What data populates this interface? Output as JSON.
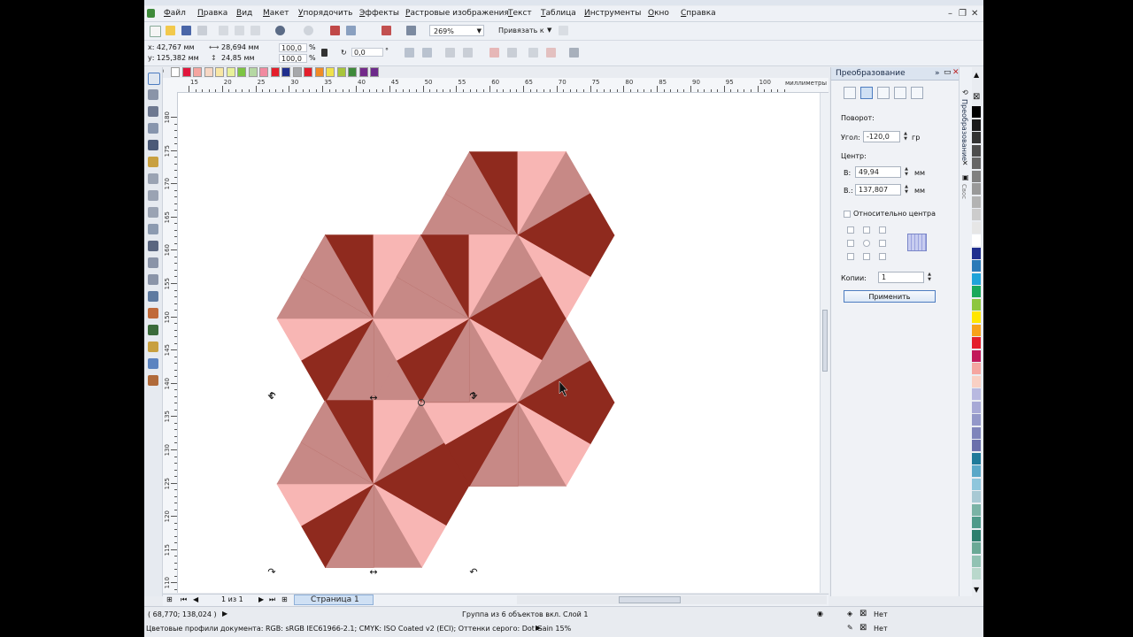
{
  "menu": {
    "items": [
      "Файл",
      "Правка",
      "Вид",
      "Макет",
      "Упорядочить",
      "Эффекты",
      "Растровые изображения",
      "Текст",
      "Таблица",
      "Инструменты",
      "Окно",
      "Справка"
    ]
  },
  "toolbar": {
    "zoom": "269%",
    "snap_label": "Привязать к"
  },
  "propbar": {
    "x": "х: 42,767 мм",
    "y": "у: 125,382 мм",
    "width": "28,694 мм",
    "height": "24,85 мм",
    "scale_w": "100,0",
    "scale_h": "100,0",
    "pct": "%",
    "rotation": "0,0",
    "deg": "°"
  },
  "colors": {
    "light": "#f8b6b4",
    "mid": "#c78986",
    "dark": "#8f2a1e",
    "accent": "#4d7cc0"
  },
  "palette_top": [
    "#ffffff",
    "#e1163c",
    "#f5a5a0",
    "#f7d7c4",
    "#f9e7a4",
    "#e8f19a",
    "#7cc443",
    "#b5d8a3",
    "#f18aa0",
    "#e41e2b",
    "#1f2e8e",
    "#a6a8ab",
    "#e41e2b",
    "#f08b25",
    "#f0e14b",
    "#a7c53b",
    "#3e8a3a",
    "#732a8a",
    "#6d2a8b"
  ],
  "palette_right": [
    "#000000",
    "#1a1a1a",
    "#333333",
    "#4d4d4d",
    "#666666",
    "#808080",
    "#999999",
    "#b3b3b3",
    "#cccccc",
    "#e6e6e6",
    "#ffffff",
    "#1f2e8e",
    "#2a7ab8",
    "#1fa3d9",
    "#19a85a",
    "#8dc63f",
    "#ffe600",
    "#f7a21b",
    "#e41e2b",
    "#c2185b",
    "#f5a5a0",
    "#f9d0c4",
    "#b8b9e0",
    "#a7a9d6",
    "#9398c9",
    "#7f85bb",
    "#6b70ac",
    "#1f7a9a",
    "#5aa8c8",
    "#8ec6dc",
    "#a8c9d4",
    "#7ab3a6",
    "#4e9a8a",
    "#2e7f6e",
    "#6aa996",
    "#91c2b3",
    "#b9d8cc"
  ],
  "ruler": {
    "h_ticks": [
      "15",
      "20",
      "25",
      "30",
      "35",
      "40",
      "45",
      "50",
      "55",
      "60",
      "65",
      "70",
      "75",
      "80",
      "85",
      "90",
      "95",
      "100"
    ],
    "h_unit": "миллиметры",
    "v_ticks": [
      "180",
      "175",
      "170",
      "165",
      "160",
      "155",
      "150",
      "145",
      "140",
      "135",
      "130",
      "125",
      "120",
      "115",
      "110"
    ]
  },
  "pagebar": {
    "page_counter": "1 из 1",
    "page_tab": "Страница 1"
  },
  "status": {
    "coords": "( 68,770; 138,024 )",
    "selection_info": "Группа из 6 объектов вкл. Слой 1",
    "color_profiles": "Цветовые профили документа: RGB: sRGB IEC61966-2.1; CMYK: ISO Coated v2 (ECI); Оттенки серого: Dot Gain 15%",
    "fill_none": "Нет",
    "outline_none": "Нет"
  },
  "docker": {
    "title": "Преобразование",
    "rotation_label": "Поворот:",
    "angle_label": "Угол:",
    "angle_value": "-120,0",
    "angle_unit": "гр",
    "center_label": "Центр:",
    "cx_label": "В:",
    "cx_value": "49,94",
    "cx_unit": "мм",
    "cy_label": "В.:",
    "cy_value": "137,807",
    "cy_unit": "мм",
    "relative_center": "Относительно центра",
    "copies_label": "Копии:",
    "copies_value": "1",
    "apply": "Применить",
    "vtab_transform": "Преобразование",
    "vtab_other": "Свoc"
  },
  "drawing": {
    "description_shapes": 6
  }
}
